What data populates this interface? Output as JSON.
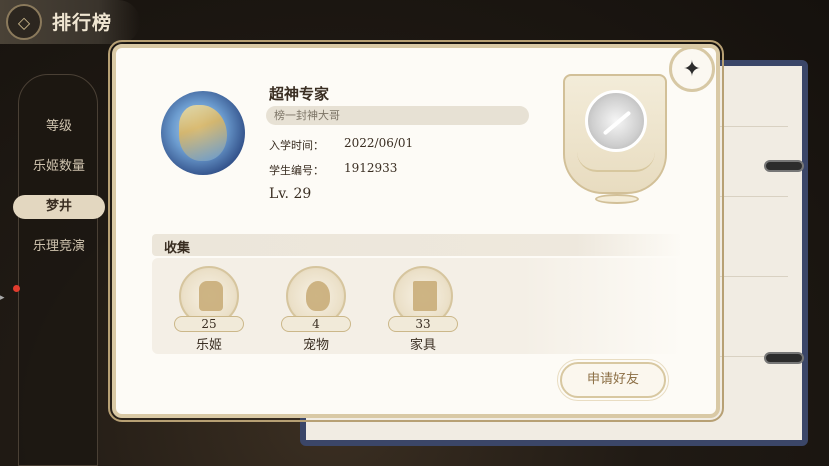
{
  "header": {
    "title": "排行榜",
    "back_icon": "back-icon"
  },
  "sidebar": {
    "items": [
      {
        "label": "等级",
        "active": false
      },
      {
        "label": "乐姬数量",
        "active": false
      },
      {
        "label": "梦井",
        "active": true
      },
      {
        "label": "乐理竞演",
        "active": false
      }
    ]
  },
  "profile": {
    "name": "超神专家",
    "motto": "榜一封神大哥",
    "enroll_label": "入学时间：",
    "enroll_value": "2022/06/01",
    "id_label": "学生编号：",
    "id_value": "1912933",
    "level_prefix": "Lv.",
    "level_value": "29"
  },
  "collection": {
    "title": "收集",
    "items": [
      {
        "count": "25",
        "label": "乐姬",
        "icon": "character-icon"
      },
      {
        "count": "4",
        "label": "宠物",
        "icon": "pet-icon"
      },
      {
        "count": "33",
        "label": "家具",
        "icon": "furniture-icon"
      }
    ]
  },
  "actions": {
    "friend_request": "申请好友"
  },
  "colors": {
    "accent": "#b7a074",
    "card_bg": "#fdfbf6",
    "text": "#3a2e22",
    "book_border": "#3b4668"
  }
}
